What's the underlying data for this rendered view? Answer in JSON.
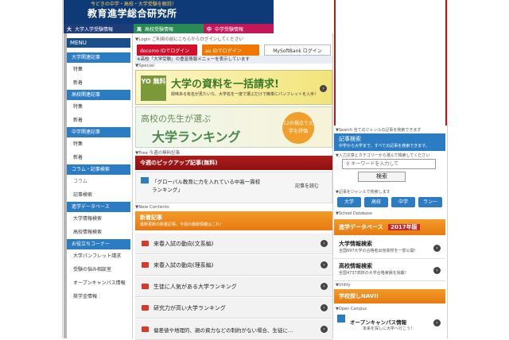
{
  "header": {
    "tagline": "今どきの中学・高校・大学受験を解説！",
    "logo": "教育進学総合研究所"
  },
  "tabs": [
    {
      "icon": "大",
      "label": "大学入学受験情報",
      "color": "#1f3c7a"
    },
    {
      "icon": "高",
      "label": "高校受験情報",
      "color": "#2a8a55"
    },
    {
      "icon": "中",
      "label": "中学受験情報",
      "color": "#c2185b"
    }
  ],
  "sidebar": {
    "title": "MENU",
    "sections": [
      {
        "label": "大学関連記事",
        "items": [
          "特集",
          "新着"
        ]
      },
      {
        "label": "高校関連記事",
        "items": [
          "特集",
          "新着"
        ]
      },
      {
        "label": "中学関連記事",
        "items": [
          "特集",
          "新着"
        ]
      }
    ],
    "column_label": "コラム・記事検索",
    "column_items": [
      "コラム",
      "記事検索"
    ],
    "db_label": "進学データベース",
    "db_items": [
      "大学情報検索",
      "高校情報検索"
    ],
    "help_label": "お役立ちコーナー",
    "help_items": [
      "大学パンフレット請求",
      "受験の悩み相談室",
      "オープンキャンパス情報",
      "奨学金情報"
    ]
  },
  "login": {
    "label": "▼Login ご利用の前にこちらからログインしてください",
    "docomo": "docomo IDでログイン",
    "au": "au IDでログイン",
    "softbank": "MySoftBank ログイン",
    "notice": "※高校「大学受験」の豊富情報メニューを表示しています"
  },
  "special": {
    "label": "▼Special",
    "banner1_badge": "YO 無料",
    "banner1_title": "大学の資料を一括請求!",
    "banner1_sub": "興味ある有名が見たいな、大学名を一度で選ぶだけで簡単にパンフレットを入手!",
    "banner2_title": "高校の先生が選ぶ",
    "banner2_main": "大学ランキング",
    "banner2_seal": "12の視点で大学を評価"
  },
  "free": {
    "label": "▼Free 今週の無料記事",
    "bar": "今週のピックアップ記事(無料)",
    "article": "「グローバル教育に力を入れている中高一貫校ランキング」",
    "read": "記事を読む"
  },
  "new_contents": {
    "label": "▼New Contents",
    "title": "新着記事",
    "sub": "最新更新の新着記事。今週の最新情報はこれ！",
    "rows": [
      "来春入試の動向(文系編)",
      "来春入試の動向(理系編)",
      "生徒に人気がある大学ランキング",
      "研究力が高い大学ランキング",
      "偏差値や地理的、親の資力などの制約がない場合、生徒に…"
    ]
  },
  "right": {
    "search_label": "▼Search 全てのジャンルの記事を検索できます",
    "search_title": "記事検索",
    "search_sub": "中学から大学まで、すべての記事を検索できます。",
    "search_hint": "▼入力文章とカテゴリーから選んで検索してください",
    "keyword_placeholder": "キーワードを入力して",
    "search_button": "検索",
    "genre_label": "▼記事をジャンルで検索します",
    "genres": [
      "大学",
      "高校",
      "中学",
      "ランー"
    ],
    "school_db_label": "▼School Database",
    "db_title": "進学データベース",
    "db_year": "2017年版",
    "uni_title": "大学情報検索",
    "uni_sub": "全国697大学の合格者出身高校を一挙公開！",
    "hs_title": "高校情報検索",
    "hs_sub": "全国4737高校の大学合格実績を掲載！",
    "utility_label": "▼Utility",
    "navi": "学校探しNAVI!",
    "oc_label": "▼Open Campus",
    "oc_title": "オープンキャンパス情報",
    "oc_sub": "未来を探しに大学へ行こう！"
  },
  "colors": {
    "navy": "#0f3a78",
    "blue": "#2c7cc4",
    "red": "#b01c1c",
    "orange": "#f08c1e",
    "green": "#5cb85c"
  }
}
